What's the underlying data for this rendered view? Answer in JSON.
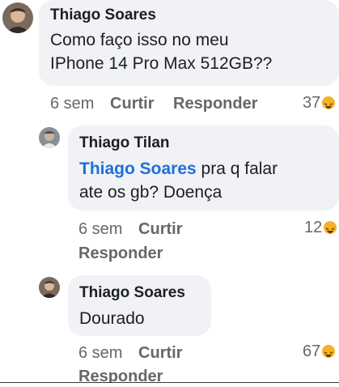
{
  "comments": [
    {
      "author": "Thiago Soares",
      "text_line1": "Como faço isso no meu",
      "text_line2": "IPhone 14 Pro Max 512GB??",
      "time": "6 sem",
      "like_label": "Curtir",
      "reply_label": "Responder",
      "reaction_count": "37",
      "reaction_icon": "haha-reaction-icon"
    },
    {
      "author": "Thiago Tilan",
      "mention": "Thiago Soares",
      "text_after_mention": " pra q falar",
      "text_line2": "ate os gb? Doença",
      "time": "6 sem",
      "like_label": "Curtir",
      "reply_label": "Responder",
      "reaction_count": "12",
      "reaction_icon": "haha-reaction-icon"
    },
    {
      "author": "Thiago Soares",
      "text_line1": "Dourado",
      "time": "6 sem",
      "like_label": "Curtir",
      "reply_label": "Responder",
      "reaction_count": "67",
      "reaction_icon": "haha-reaction-icon"
    }
  ],
  "colors": {
    "bubble": "#f0f2f5",
    "mention": "#216fdb",
    "meta_text": "#65676b",
    "haha_reaction": "#f7b125"
  }
}
